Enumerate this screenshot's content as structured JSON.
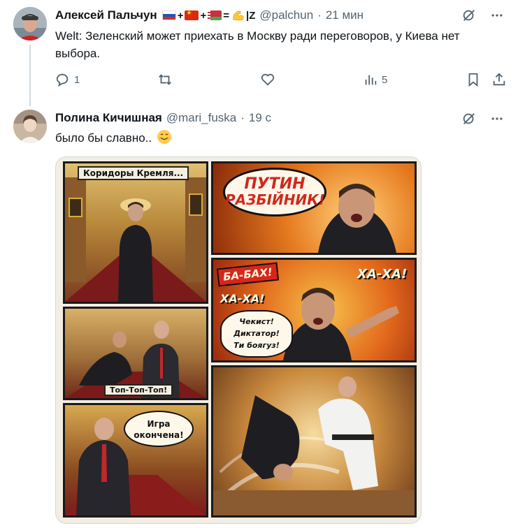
{
  "tweet1": {
    "name": "Алексей Пальчун",
    "flag_separators": [
      "+",
      "+",
      "="
    ],
    "name_suffix": "|Z",
    "handle": "@palchun",
    "separator": "·",
    "time": "21 мин",
    "text": "Welt: Зеленский может приехать в Москву ради переговоров, у Киева нет выбора.",
    "actions": {
      "reply_count": "1",
      "views_count": "5"
    }
  },
  "tweet2": {
    "name": "Полина Кичишная",
    "handle": "@mari_fuska",
    "separator": "·",
    "time": "19 с",
    "text": "было бы славно..",
    "comic": {
      "panel1_caption": "Коридоры Кремля...",
      "panel2_bubble_line1": "ПУТИН",
      "panel2_bubble_line2": "РАЗБІЙНИК!",
      "panel3_bang": "БА-БАХ!",
      "panel3_haha_left": "ХА-ХА!",
      "panel3_haha_right": "ХА-ХА!",
      "panel3_speech_line1": "Чекист!",
      "panel3_speech_line2": "Диктатор!",
      "panel3_speech_line3": "Ти боягуз!",
      "panel4_caption": "Топ-Топ-Топ!",
      "panel5_bubble_line1": "Игра",
      "panel5_bubble_line2": "окончена!"
    }
  },
  "icons": {
    "grok": "grok-icon",
    "more": "more-icon",
    "reply": "reply-icon",
    "retweet": "retweet-icon",
    "like": "like-icon",
    "views": "views-icon",
    "bookmark": "bookmark-icon",
    "share": "share-icon"
  },
  "colors": {
    "text_primary": "#0f1419",
    "text_secondary": "#536471",
    "thread_line": "#cfd9de"
  }
}
